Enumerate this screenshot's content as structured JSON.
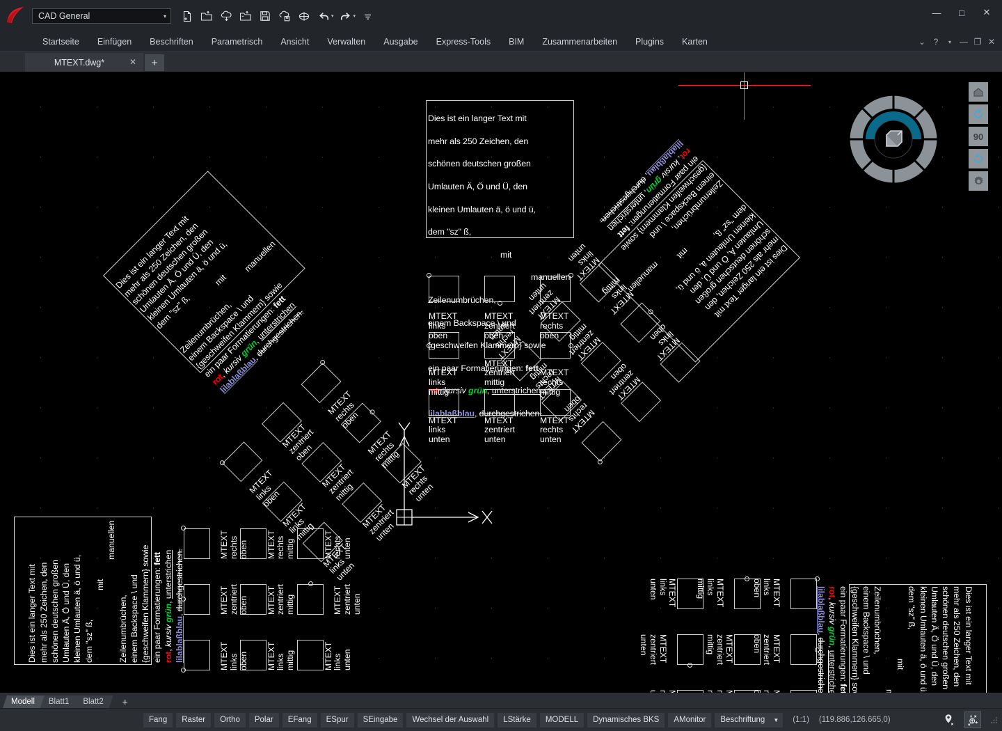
{
  "titlebar": {
    "workspace_selector": {
      "value": "CAD General",
      "caret": "▾"
    },
    "quick_access": [
      {
        "name": "new-file-icon",
        "tip": "Neu"
      },
      {
        "name": "open-file-icon",
        "tip": "Öffnen"
      },
      {
        "name": "cloud-download-icon",
        "tip": "Herunterladen"
      },
      {
        "name": "open-cloud-folder-icon",
        "tip": "Aus Cloud öffnen"
      },
      {
        "name": "save-icon",
        "tip": "Speichern"
      },
      {
        "name": "cloud-save-icon",
        "tip": "In Cloud speichern"
      },
      {
        "name": "plot-icon",
        "tip": "Plotten"
      },
      {
        "name": "undo-icon",
        "tip": "Rückgängig"
      },
      {
        "name": "redo-icon",
        "tip": "Wiederholen"
      },
      {
        "name": "more-icon",
        "tip": "Mehr"
      }
    ],
    "window_controls": {
      "minimize": "—",
      "maximize": "□",
      "close": "✕"
    }
  },
  "ribbon": {
    "tabs": [
      "Startseite",
      "Einfügen",
      "Beschriften",
      "Parametrisch",
      "Ansicht",
      "Verwalten",
      "Ausgabe",
      "Express-Tools",
      "BIM",
      "Zusammenarbeiten",
      "Plugins",
      "Karten"
    ],
    "right_controls": {
      "collapse": "⌄",
      "help": "?",
      "help_caret": "▾",
      "minimize": "—",
      "restore": "❐",
      "close": "✕"
    }
  },
  "file_tabs": {
    "tabs": [
      {
        "name": "MTEXT.dwg*",
        "close": "✕",
        "modified": true
      }
    ],
    "add_tab": "+"
  },
  "canvas": {
    "background_color": "#000000",
    "crosshair": {
      "horizontal_color": "#ff2a2a",
      "vertical_color": "#15d915"
    },
    "long_text": {
      "lines": [
        "Dies ist ein langer Text mit",
        "mehr als 250 Zeichen, den",
        "schönen deutschen großen",
        "Umlauten Ä, Ö und Ü, den",
        "kleinen Umlauten ä, ö und ü,",
        "dem \"sz\" ß,",
        "mit",
        "manuellen",
        "Zeilenumbrüchen,",
        "einem Backspace \\ und",
        "{geschweifen Klammern} sowie",
        "ein paar Formatierungen: fett",
        "rot, kursiv grün, unterstrichen",
        "lilablaßblau, durchgestrichen."
      ],
      "format_words": {
        "bold": "fett",
        "red": "rot",
        "italic": "kursiv",
        "green": "grün",
        "underline": "unterstrichen",
        "lilac": "lilablaßblau",
        "strikethrough": "durchgestrichen."
      },
      "colors": {
        "red": "#ff0000",
        "green": "#00cc33",
        "lilac": "#8f8fd8",
        "default": "#ffffff"
      }
    },
    "mtext_label_prefix": "MTEXT",
    "mtext_justifications": [
      {
        "h": "links",
        "v": "oben"
      },
      {
        "h": "zentriert",
        "v": "oben"
      },
      {
        "h": "rechts",
        "v": "oben"
      },
      {
        "h": "links",
        "v": "mittig"
      },
      {
        "h": "zentriert",
        "v": "mittig"
      },
      {
        "h": "rechts",
        "v": "mittig"
      },
      {
        "h": "links",
        "v": "unten"
      },
      {
        "h": "zentriert",
        "v": "unten"
      },
      {
        "h": "rechts",
        "v": "unten"
      }
    ],
    "ucs": {
      "x_axis": "X",
      "y_axis": "Y"
    },
    "nav_buttons": [
      {
        "name": "home-icon",
        "label": "⌂"
      },
      {
        "name": "rotate-ccw-icon",
        "label": "↺"
      },
      {
        "name": "rotate-angle-value",
        "label": "90"
      },
      {
        "name": "rotate-cw-icon",
        "label": "↻"
      },
      {
        "name": "settings-gear-icon",
        "label": "⚙"
      }
    ]
  },
  "layout_tabs": {
    "tabs": [
      {
        "label": "Modell",
        "active": true
      },
      {
        "label": "Blatt1",
        "active": false
      },
      {
        "label": "Blatt2",
        "active": false
      }
    ],
    "add": "+"
  },
  "statusbar": {
    "buttons": [
      "Fang",
      "Raster",
      "Ortho",
      "Polar",
      "EFang",
      "ESpur",
      "SEingabe",
      "Wechsel der Auswahl",
      "LStärke",
      "MODELL",
      "Dynamisches BKS",
      "AMonitor"
    ],
    "annotation_scale": {
      "value": "Beschriftung",
      "caret": "▼"
    },
    "scale_ratio": "(1:1)",
    "coordinates": "(119.886,126.665,0)",
    "right_icons": [
      {
        "name": "location-pin-icon",
        "label": "📍"
      },
      {
        "name": "isolate-objects-icon",
        "label": "⊕"
      },
      {
        "name": "resize-grip-icon",
        "label": "⋰"
      }
    ]
  }
}
